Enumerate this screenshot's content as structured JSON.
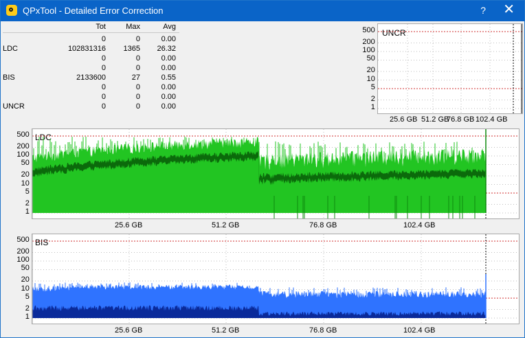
{
  "window": {
    "title": "QPxTool - Detailed Error Correction",
    "help_label": "?",
    "close_label": "✕"
  },
  "stats": {
    "headers": [
      "Tot",
      "Max",
      "Avg"
    ],
    "rows": [
      {
        "label": "",
        "tot": "0",
        "max": "0",
        "avg": "0.00"
      },
      {
        "label": "LDC",
        "tot": "102831316",
        "max": "1365",
        "avg": "26.32"
      },
      {
        "label": "",
        "tot": "0",
        "max": "0",
        "avg": "0.00"
      },
      {
        "label": "",
        "tot": "0",
        "max": "0",
        "avg": "0.00"
      },
      {
        "label": "BIS",
        "tot": "2133600",
        "max": "27",
        "avg": "0.55"
      },
      {
        "label": "",
        "tot": "0",
        "max": "0",
        "avg": "0.00"
      },
      {
        "label": "",
        "tot": "0",
        "max": "0",
        "avg": "0.00"
      },
      {
        "label": "UNCR",
        "tot": "0",
        "max": "0",
        "avg": "0.00"
      }
    ]
  },
  "chart_data": [
    {
      "type": "area",
      "title": "UNCR",
      "y_scale": "log",
      "y_ticks": [
        "500",
        "200",
        "100",
        "50",
        "20",
        "10",
        "5",
        "2",
        "1"
      ],
      "x_ticks": [
        "25.6 GB",
        "51.2 GB",
        "76.8 GB",
        "102.4 GB"
      ],
      "series": [
        {
          "values": []
        }
      ]
    },
    {
      "type": "area",
      "title": "LDC",
      "y_scale": "log",
      "y_ticks": [
        "500",
        "200",
        "100",
        "50",
        "20",
        "10",
        "5",
        "2",
        "1"
      ],
      "x_ticks": [
        "25.6 GB",
        "51.2 GB",
        "76.8 GB",
        "102.4 GB"
      ],
      "colors": {
        "max": "#22c522",
        "avg": "#0b6a0b"
      }
    },
    {
      "type": "area",
      "title": "BIS",
      "y_scale": "log",
      "y_ticks": [
        "500",
        "200",
        "100",
        "50",
        "20",
        "10",
        "5",
        "2",
        "1"
      ],
      "x_ticks": [
        "25.6 GB",
        "51.2 GB",
        "76.8 GB",
        "102.4 GB"
      ],
      "colors": {
        "max": "#2f73ff",
        "avg": "#0a2a9a"
      }
    }
  ]
}
